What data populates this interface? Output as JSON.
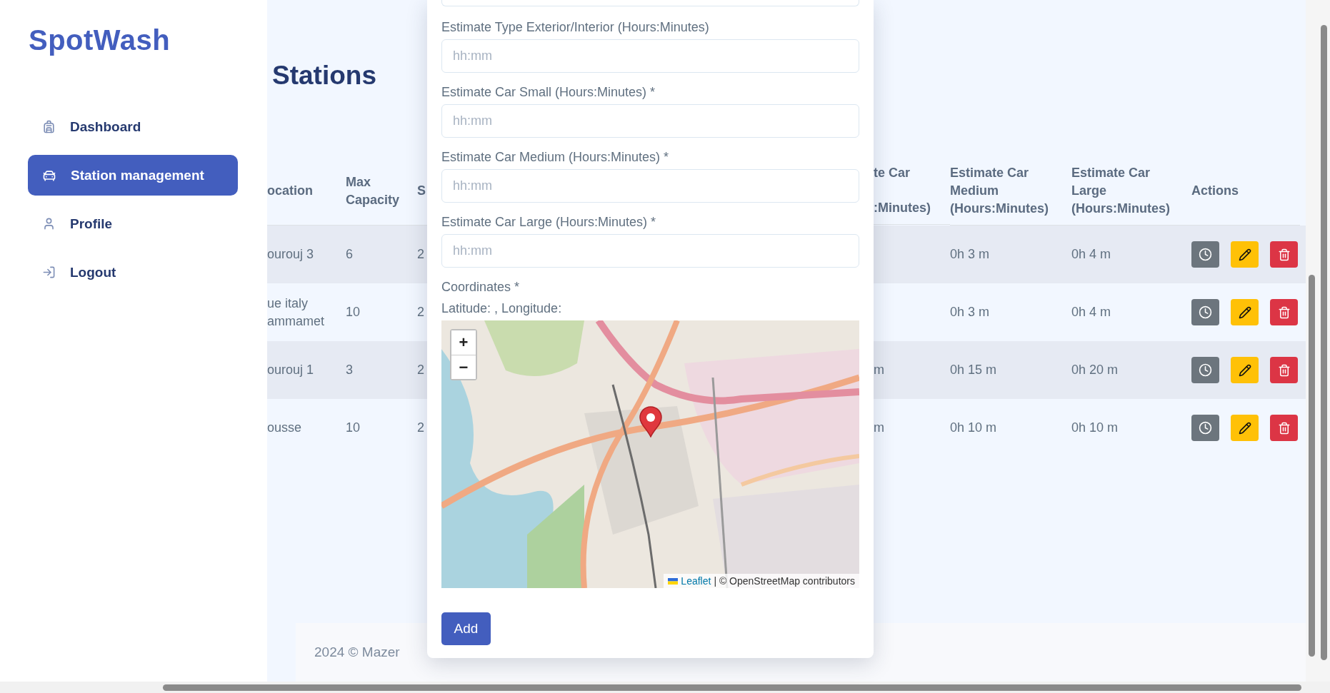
{
  "sidebar": {
    "logo": "SpotWash",
    "items": [
      {
        "label": "Dashboard",
        "selected": false
      },
      {
        "label": "Station management",
        "selected": true
      },
      {
        "label": "Profile",
        "selected": false
      },
      {
        "label": "Logout",
        "selected": false
      }
    ]
  },
  "page": {
    "title": "Stations"
  },
  "table": {
    "columns": [
      {
        "label": "ocation"
      },
      {
        "label": "Max Capacity"
      },
      {
        "label": "S"
      },
      {
        "kind": "split",
        "lines": [
          "te Car",
          ":Minutes)"
        ]
      },
      {
        "label": "Estimate Car Medium (Hours:Minutes)"
      },
      {
        "label": "Estimate Car Large (Hours:Minutes)"
      },
      {
        "label": "Actions"
      }
    ],
    "rows": [
      {
        "location": "ourouj 3",
        "max_capacity": "6",
        "column_3": "2",
        "medium": "0h 3 m",
        "large": "0h 4 m"
      },
      {
        "location": "ue italy\nammamet",
        "max_capacity": "10",
        "column_3": "2",
        "medium": "0h 3 m",
        "large": "0h 4 m"
      },
      {
        "location": "ourouj 1",
        "max_capacity": "3",
        "column_3": "2",
        "column_4": "m",
        "medium": "0h 15 m",
        "large": "0h 20 m"
      },
      {
        "location": "ousse",
        "max_capacity": "10",
        "column_3": "2",
        "column_4": "m",
        "medium": "0h 10 m",
        "large": "0h 10 m"
      }
    ]
  },
  "modal": {
    "fields": [
      {
        "label": "Estimate Type Exterior/Interior (Hours:Minutes)",
        "placeholder": "hh:mm"
      },
      {
        "label": "Estimate Car Small (Hours:Minutes) *",
        "placeholder": "hh:mm"
      },
      {
        "label": "Estimate Car Medium (Hours:Minutes) *",
        "placeholder": "hh:mm"
      },
      {
        "label": "Estimate Car Large (Hours:Minutes) *",
        "placeholder": "hh:mm"
      }
    ],
    "coordinates_label": "Coordinates *",
    "coordinates_value": "Latitude: , Longitude:",
    "map": {
      "zoom_in": "+",
      "zoom_out": "−",
      "attribution_link": "Leaflet",
      "attribution_text": "| © OpenStreetMap contributors"
    },
    "submit": "Add"
  },
  "footer": {
    "text": "2024 © Mazer"
  }
}
